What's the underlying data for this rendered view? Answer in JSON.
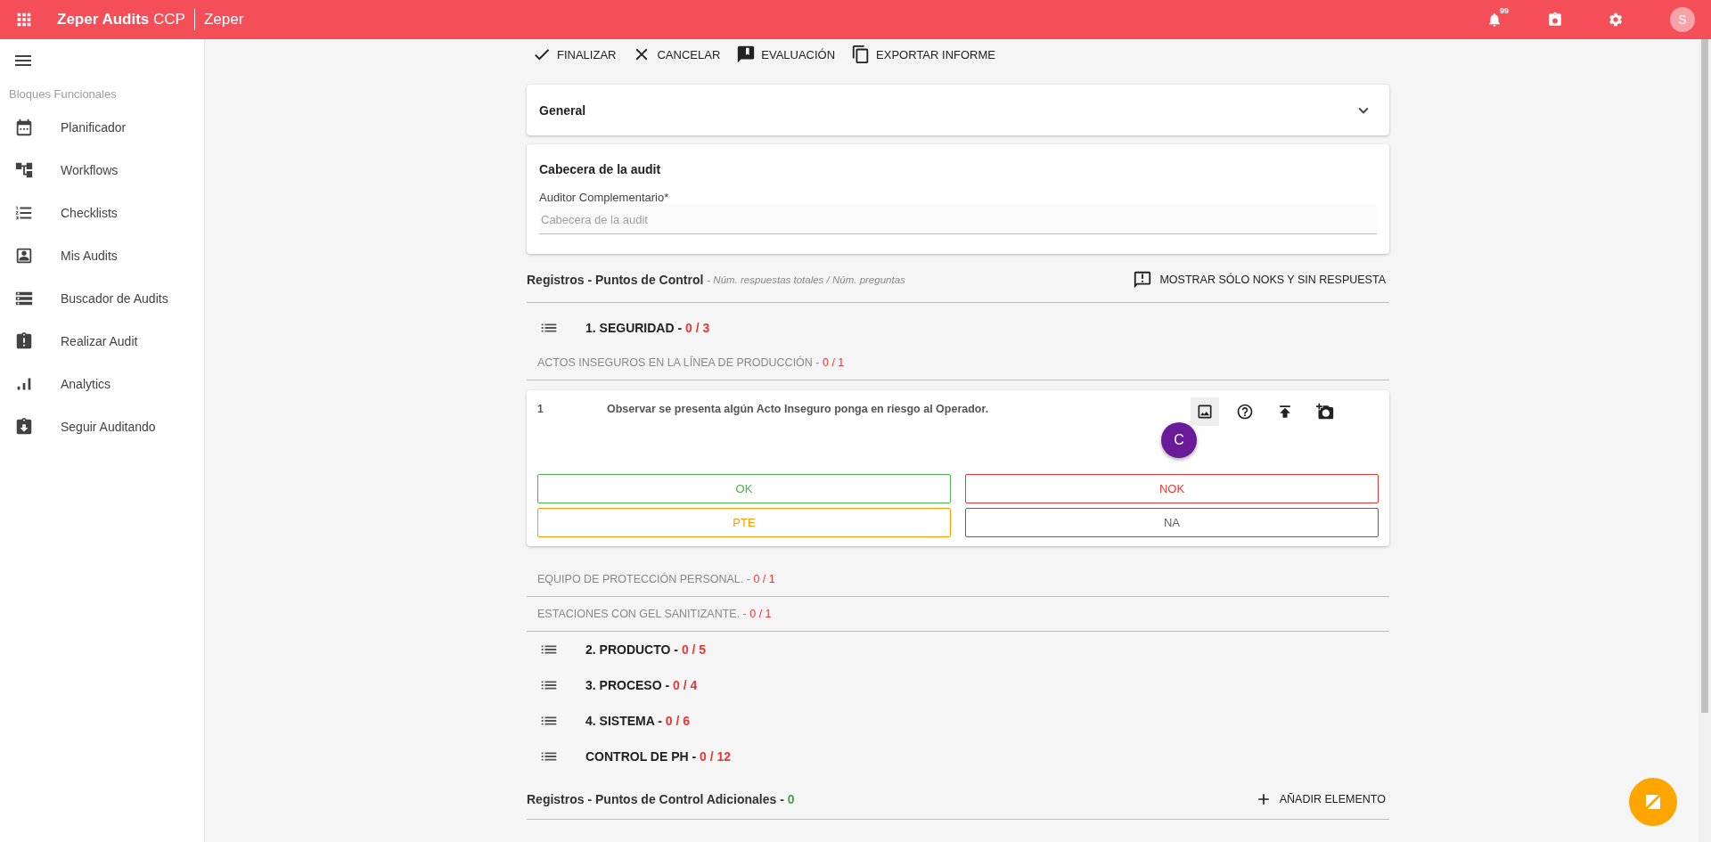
{
  "app_bar": {
    "title": "Zeper Audits",
    "title_suffix": "CCP",
    "subtitle": "Zeper",
    "notification_count": "99",
    "avatar_initial": "S"
  },
  "sidebar": {
    "section_title": "Bloques Funcionales",
    "items": [
      {
        "label": "Planificador",
        "kind": "calendar"
      },
      {
        "label": "Workflows",
        "kind": "workflow"
      },
      {
        "label": "Checklists",
        "kind": "checklist"
      },
      {
        "label": "Mis Audits",
        "kind": "contact"
      },
      {
        "label": "Buscador de Audits",
        "kind": "storage"
      },
      {
        "label": "Realizar Audit",
        "kind": "clipboard-alert"
      },
      {
        "label": "Analytics",
        "kind": "bars"
      },
      {
        "label": "Seguir Auditando",
        "kind": "clipboard-down"
      }
    ]
  },
  "toolbar": [
    {
      "label": "FINALIZAR",
      "kind": "check"
    },
    {
      "label": "CANCELAR",
      "kind": "close"
    },
    {
      "label": "EVALUACIÓN",
      "kind": "feedback"
    },
    {
      "label": "EXPORTAR INFORME",
      "kind": "copy"
    }
  ],
  "general_panel": {
    "title": "General",
    "expanded": false
  },
  "header_card": {
    "title": "Cabecera de la audit",
    "field_label": "Auditor Complementario*",
    "placeholder": "Cabecera de la audit"
  },
  "records": {
    "title": "Registros - Puntos de Control",
    "hint": "- Núm. respuestas totales / Núm. preguntas",
    "filter_button": "MOSTRAR SÓLO NOKS Y SIN RESPUESTA",
    "sections": [
      {
        "title": "1. SEGURIDAD -",
        "count": "0 / 3",
        "groups": [
          {
            "title": "ACTOS INSEGUROS EN LA LÍNEA DE PRODUCCIÓN -",
            "count": "0 / 1",
            "questions": [
              {
                "number": "1",
                "text": "Observar se presenta algún Acto Inseguro ponga en riesgo al  Operador.",
                "actions": [
                  {
                    "kind": "image",
                    "highlighted": true
                  },
                  {
                    "kind": "help",
                    "highlighted": false
                  },
                  {
                    "kind": "upload",
                    "highlighted": false
                  },
                  {
                    "kind": "photo",
                    "highlighted": false
                  }
                ],
                "answers": [
                  {
                    "label": "OK",
                    "color": "#4caf50"
                  },
                  {
                    "label": "NOK",
                    "color": "#e53935"
                  },
                  {
                    "label": "PTE",
                    "color": "#ff9800"
                  },
                  {
                    "label": "NA",
                    "color": "#616161"
                  }
                ]
              }
            ]
          },
          {
            "title": "EQUIPO DE PROTECCIÓN PERSONAL. -",
            "count": "0 / 1"
          },
          {
            "title": "ESTACIONES CON GEL SANITIZANTE. -",
            "count": "0 / 1"
          }
        ]
      },
      {
        "title": "2. PRODUCTO -",
        "count": "0 / 5"
      },
      {
        "title": "3. PROCESO -",
        "count": "0 / 4"
      },
      {
        "title": "4. SISTEMA -",
        "count": "0 / 6"
      },
      {
        "title": "CONTROL DE PH -",
        "count": "0 / 12"
      }
    ]
  },
  "additional": {
    "title": "Registros - Puntos de Control Adicionales -",
    "count": "0",
    "add_button": "AÑADIR ELEMENTO"
  },
  "tour_bubble": "C"
}
